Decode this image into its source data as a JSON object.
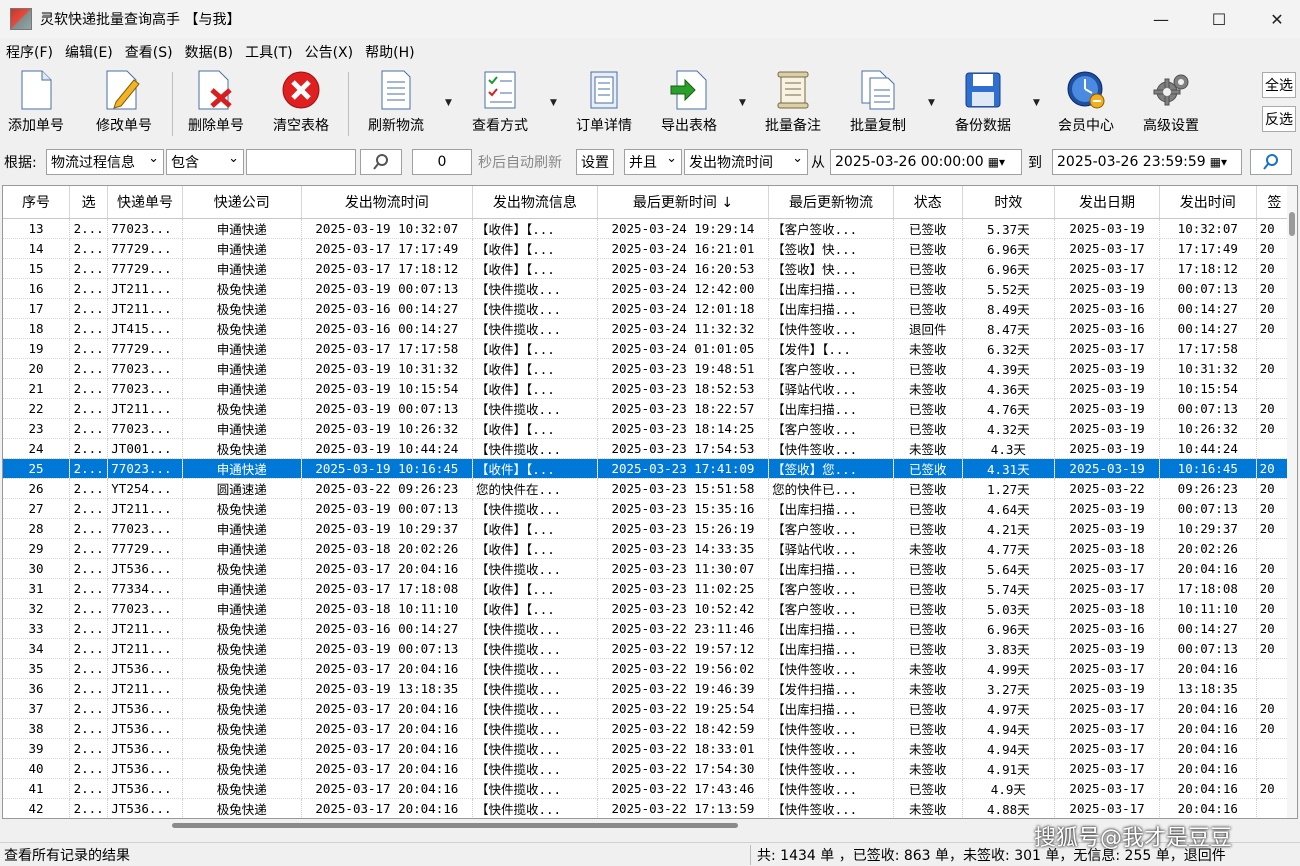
{
  "window": {
    "title": "灵软快递批量查询高手 【与我】",
    "minimize": "—",
    "maximize": "☐",
    "close": "✕"
  },
  "menu": [
    "程序(F)",
    "编辑(E)",
    "查看(S)",
    "数据(B)",
    "工具(T)",
    "公告(X)",
    "帮助(H)"
  ],
  "toolbar": {
    "add": "添加单号",
    "edit": "修改单号",
    "delete": "删除单号",
    "clear": "清空表格",
    "refresh": "刷新物流",
    "view_mode": "查看方式",
    "order_detail": "订单详情",
    "export": "导出表格",
    "batch_note": "批量备注",
    "batch_copy": "批量复制",
    "backup": "备份数据",
    "member": "会员中心",
    "advanced": "高级设置",
    "select_all": "全选",
    "invert": "反选"
  },
  "filter": {
    "label": "根据:",
    "field": "物流过程信息",
    "op": "包含",
    "keyword": "",
    "refresh_seconds": "0",
    "refresh_text": "秒后自动刷新",
    "settings": "设置",
    "logic": "并且",
    "date_field": "发出物流时间",
    "from": "从",
    "start": "2025-03-26 00:00:00",
    "to": "到",
    "end": "2025-03-26 23:59:59"
  },
  "table": {
    "columns": [
      "序号",
      "选",
      "快递单号",
      "快递公司",
      "发出物流时间",
      "发出物流信息",
      "最后更新时间 ↓",
      "最后更新物流",
      "状态",
      "时效",
      "发出日期",
      "发出时间",
      "签"
    ],
    "selected_row": 12,
    "rows": [
      [
        "13",
        "2...",
        "77023...",
        "申通快递",
        "2025-03-19 10:32:07",
        "【收件】【...",
        "2025-03-24 19:29:14",
        "【客户签收...",
        "已签收",
        "5.37天",
        "2025-03-19",
        "10:32:07",
        "20"
      ],
      [
        "14",
        "2...",
        "77729...",
        "申通快递",
        "2025-03-17 17:17:49",
        "【收件】【...",
        "2025-03-24 16:21:01",
        "【签收】快...",
        "已签收",
        "6.96天",
        "2025-03-17",
        "17:17:49",
        "20"
      ],
      [
        "15",
        "2...",
        "77729...",
        "申通快递",
        "2025-03-17 17:18:12",
        "【收件】【...",
        "2025-03-24 16:20:53",
        "【签收】快...",
        "已签收",
        "6.96天",
        "2025-03-17",
        "17:18:12",
        "20"
      ],
      [
        "16",
        "2...",
        "JT211...",
        "极兔快递",
        "2025-03-19 00:07:13",
        "【快件揽收...",
        "2025-03-24 12:42:00",
        "【出库扫描...",
        "已签收",
        "5.52天",
        "2025-03-19",
        "00:07:13",
        "20"
      ],
      [
        "17",
        "2...",
        "JT211...",
        "极兔快递",
        "2025-03-16 00:14:27",
        "【快件揽收...",
        "2025-03-24 12:01:18",
        "【出库扫描...",
        "已签收",
        "8.49天",
        "2025-03-16",
        "00:14:27",
        "20"
      ],
      [
        "18",
        "2...",
        "JT415...",
        "极兔快递",
        "2025-03-16 00:14:27",
        "【快件揽收...",
        "2025-03-24 11:32:32",
        "【快件签收...",
        "退回件",
        "8.47天",
        "2025-03-16",
        "00:14:27",
        "20"
      ],
      [
        "19",
        "2...",
        "77729...",
        "申通快递",
        "2025-03-17 17:17:58",
        "【收件】【...",
        "2025-03-24 01:01:05",
        "【发件】【...",
        "未签收",
        "6.32天",
        "2025-03-17",
        "17:17:58",
        ""
      ],
      [
        "20",
        "2...",
        "77023...",
        "申通快递",
        "2025-03-19 10:31:32",
        "【收件】【...",
        "2025-03-23 19:48:51",
        "【客户签收...",
        "已签收",
        "4.39天",
        "2025-03-19",
        "10:31:32",
        "20"
      ],
      [
        "21",
        "2...",
        "77023...",
        "申通快递",
        "2025-03-19 10:15:54",
        "【收件】【...",
        "2025-03-23 18:52:53",
        "【驿站代收...",
        "未签收",
        "4.36天",
        "2025-03-19",
        "10:15:54",
        ""
      ],
      [
        "22",
        "2...",
        "JT211...",
        "极兔快递",
        "2025-03-19 00:07:13",
        "【快件揽收...",
        "2025-03-23 18:22:57",
        "【出库扫描...",
        "已签收",
        "4.76天",
        "2025-03-19",
        "00:07:13",
        "20"
      ],
      [
        "23",
        "2...",
        "77023...",
        "申通快递",
        "2025-03-19 10:26:32",
        "【收件】【...",
        "2025-03-23 18:14:25",
        "【客户签收...",
        "已签收",
        "4.32天",
        "2025-03-19",
        "10:26:32",
        "20"
      ],
      [
        "24",
        "2...",
        "JT001...",
        "极兔快递",
        "2025-03-19 10:44:24",
        "【快件揽收...",
        "2025-03-23 17:54:53",
        "【快件签收...",
        "未签收",
        "4.3天",
        "2025-03-19",
        "10:44:24",
        ""
      ],
      [
        "25",
        "2...",
        "77023...",
        "申通快递",
        "2025-03-19 10:16:45",
        "【收件】【...",
        "2025-03-23 17:41:09",
        "【签收】您...",
        "已签收",
        "4.31天",
        "2025-03-19",
        "10:16:45",
        "20"
      ],
      [
        "26",
        "2...",
        "YT254...",
        "圆通速递",
        "2025-03-22 09:26:23",
        "您的快件在...",
        "2025-03-23 15:51:58",
        "您的快件已...",
        "已签收",
        "1.27天",
        "2025-03-22",
        "09:26:23",
        "20"
      ],
      [
        "27",
        "2...",
        "JT211...",
        "极兔快递",
        "2025-03-19 00:07:13",
        "【快件揽收...",
        "2025-03-23 15:35:16",
        "【出库扫描...",
        "已签收",
        "4.64天",
        "2025-03-19",
        "00:07:13",
        "20"
      ],
      [
        "28",
        "2...",
        "77023...",
        "申通快递",
        "2025-03-19 10:29:37",
        "【收件】【...",
        "2025-03-23 15:26:19",
        "【客户签收...",
        "已签收",
        "4.21天",
        "2025-03-19",
        "10:29:37",
        "20"
      ],
      [
        "29",
        "2...",
        "77729...",
        "申通快递",
        "2025-03-18 20:02:26",
        "【收件】【...",
        "2025-03-23 14:33:35",
        "【驿站代收...",
        "未签收",
        "4.77天",
        "2025-03-18",
        "20:02:26",
        ""
      ],
      [
        "30",
        "2...",
        "JT536...",
        "极兔快递",
        "2025-03-17 20:04:16",
        "【快件揽收...",
        "2025-03-23 11:30:07",
        "【出库扫描...",
        "已签收",
        "5.64天",
        "2025-03-17",
        "20:04:16",
        "20"
      ],
      [
        "31",
        "2...",
        "77334...",
        "申通快递",
        "2025-03-17 17:18:08",
        "【收件】【...",
        "2025-03-23 11:02:25",
        "【客户签收...",
        "已签收",
        "5.74天",
        "2025-03-17",
        "17:18:08",
        "20"
      ],
      [
        "32",
        "2...",
        "77023...",
        "申通快递",
        "2025-03-18 10:11:10",
        "【收件】【...",
        "2025-03-23 10:52:42",
        "【客户签收...",
        "已签收",
        "5.03天",
        "2025-03-18",
        "10:11:10",
        "20"
      ],
      [
        "33",
        "2...",
        "JT211...",
        "极兔快递",
        "2025-03-16 00:14:27",
        "【快件揽收...",
        "2025-03-22 23:11:46",
        "【出库扫描...",
        "已签收",
        "6.96天",
        "2025-03-16",
        "00:14:27",
        "20"
      ],
      [
        "34",
        "2...",
        "JT211...",
        "极兔快递",
        "2025-03-19 00:07:13",
        "【快件揽收...",
        "2025-03-22 19:57:12",
        "【出库扫描...",
        "已签收",
        "3.83天",
        "2025-03-19",
        "00:07:13",
        "20"
      ],
      [
        "35",
        "2...",
        "JT536...",
        "极兔快递",
        "2025-03-17 20:04:16",
        "【快件揽收...",
        "2025-03-22 19:56:02",
        "【快件签收...",
        "未签收",
        "4.99天",
        "2025-03-17",
        "20:04:16",
        ""
      ],
      [
        "36",
        "2...",
        "JT211...",
        "极兔快递",
        "2025-03-19 13:18:35",
        "【快件揽收...",
        "2025-03-22 19:46:39",
        "【发件扫描...",
        "未签收",
        "3.27天",
        "2025-03-19",
        "13:18:35",
        ""
      ],
      [
        "37",
        "2...",
        "JT536...",
        "极兔快递",
        "2025-03-17 20:04:16",
        "【快件揽收...",
        "2025-03-22 19:25:54",
        "【出库扫描...",
        "已签收",
        "4.97天",
        "2025-03-17",
        "20:04:16",
        "20"
      ],
      [
        "38",
        "2...",
        "JT536...",
        "极兔快递",
        "2025-03-17 20:04:16",
        "【快件揽收...",
        "2025-03-22 18:42:59",
        "【快件签收...",
        "已签收",
        "4.94天",
        "2025-03-17",
        "20:04:16",
        "20"
      ],
      [
        "39",
        "2...",
        "JT536...",
        "极兔快递",
        "2025-03-17 20:04:16",
        "【快件揽收...",
        "2025-03-22 18:33:01",
        "【快件签收...",
        "未签收",
        "4.94天",
        "2025-03-17",
        "20:04:16",
        ""
      ],
      [
        "40",
        "2...",
        "JT536...",
        "极兔快递",
        "2025-03-17 20:04:16",
        "【快件揽收...",
        "2025-03-22 17:54:30",
        "【快件签收...",
        "未签收",
        "4.91天",
        "2025-03-17",
        "20:04:16",
        ""
      ],
      [
        "41",
        "2...",
        "JT536...",
        "极兔快递",
        "2025-03-17 20:04:16",
        "【快件揽收...",
        "2025-03-22 17:43:46",
        "【快件签收...",
        "已签收",
        "4.9天",
        "2025-03-17",
        "20:04:16",
        "20"
      ],
      [
        "42",
        "2...",
        "JT536...",
        "极兔快递",
        "2025-03-17 20:04:16",
        "【快件揽收...",
        "2025-03-22 17:13:59",
        "【快件签收...",
        "未签收",
        "4.88天",
        "2025-03-17",
        "20:04:16",
        ""
      ]
    ]
  },
  "status": {
    "left": "查看所有记录的结果",
    "right": "共: 1434 单 ，已签收:  863 单，未签收: 301 单，无信息: 255 单，退回件",
    "watermark": "搜狐号@我才是豆豆"
  },
  "colors": {
    "selection": "#0078d7",
    "delete_red": "#e02020",
    "refresh_blue": "#1a6fc9"
  }
}
